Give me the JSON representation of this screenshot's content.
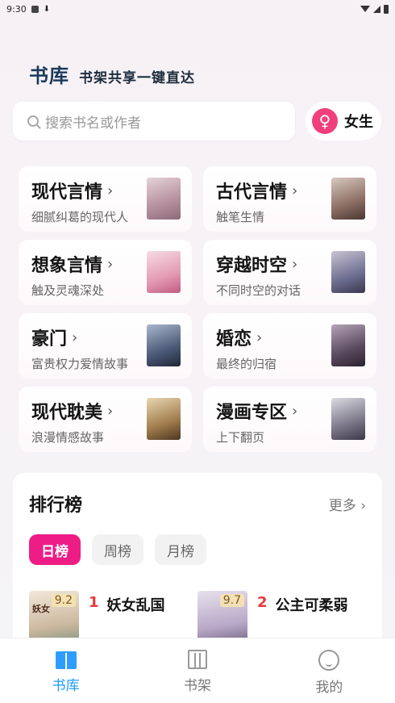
{
  "status_bar": {
    "time": "9:30"
  },
  "header": {
    "logo": "书库",
    "slogan": "书架共享一键直达"
  },
  "search": {
    "placeholder": "搜索书名或作者"
  },
  "gender": {
    "label": "女生",
    "icon": "female-icon"
  },
  "categories": [
    {
      "title": "现代言情",
      "subtitle": "细腻纠葛的现代人",
      "cover_color": "#c9a7b2"
    },
    {
      "title": "古代言情",
      "subtitle": "触笔生情",
      "cover_color": "#a8908a"
    },
    {
      "title": "想象言情",
      "subtitle": "触及灵魂深处",
      "cover_color": "#e8a9bd"
    },
    {
      "title": "穿越时空",
      "subtitle": "不同时空的对话",
      "cover_color": "#7f8aa8"
    },
    {
      "title": "豪门",
      "subtitle": "富贵权力爱情故事",
      "cover_color": "#4b5a78"
    },
    {
      "title": "婚恋",
      "subtitle": "最终的归宿",
      "cover_color": "#5a4a5e"
    },
    {
      "title": "现代耽美",
      "subtitle": "浪漫情感故事",
      "cover_color": "#8a6b46"
    },
    {
      "title": "漫画专区",
      "subtitle": "上下翻页",
      "cover_color": "#6f6a78"
    }
  ],
  "ranking": {
    "title": "排行榜",
    "more": "更多",
    "tabs": [
      "日榜",
      "周榜",
      "月榜"
    ],
    "active_tab": "日榜",
    "items": [
      {
        "rank": "1",
        "name": "妖女乱国",
        "score": "9.2",
        "cover_color": "#d9cdbb",
        "cover_text": "妖女"
      },
      {
        "rank": "2",
        "name": "公主可柔弱",
        "score": "9.7",
        "cover_color": "#c7b9cf",
        "cover_text": ""
      }
    ]
  },
  "tabbar": {
    "items": [
      {
        "label": "书库",
        "icon": "library-icon",
        "active": true
      },
      {
        "label": "书架",
        "icon": "bookshelf-icon",
        "active": false
      },
      {
        "label": "我的",
        "icon": "profile-icon",
        "active": false
      }
    ]
  }
}
